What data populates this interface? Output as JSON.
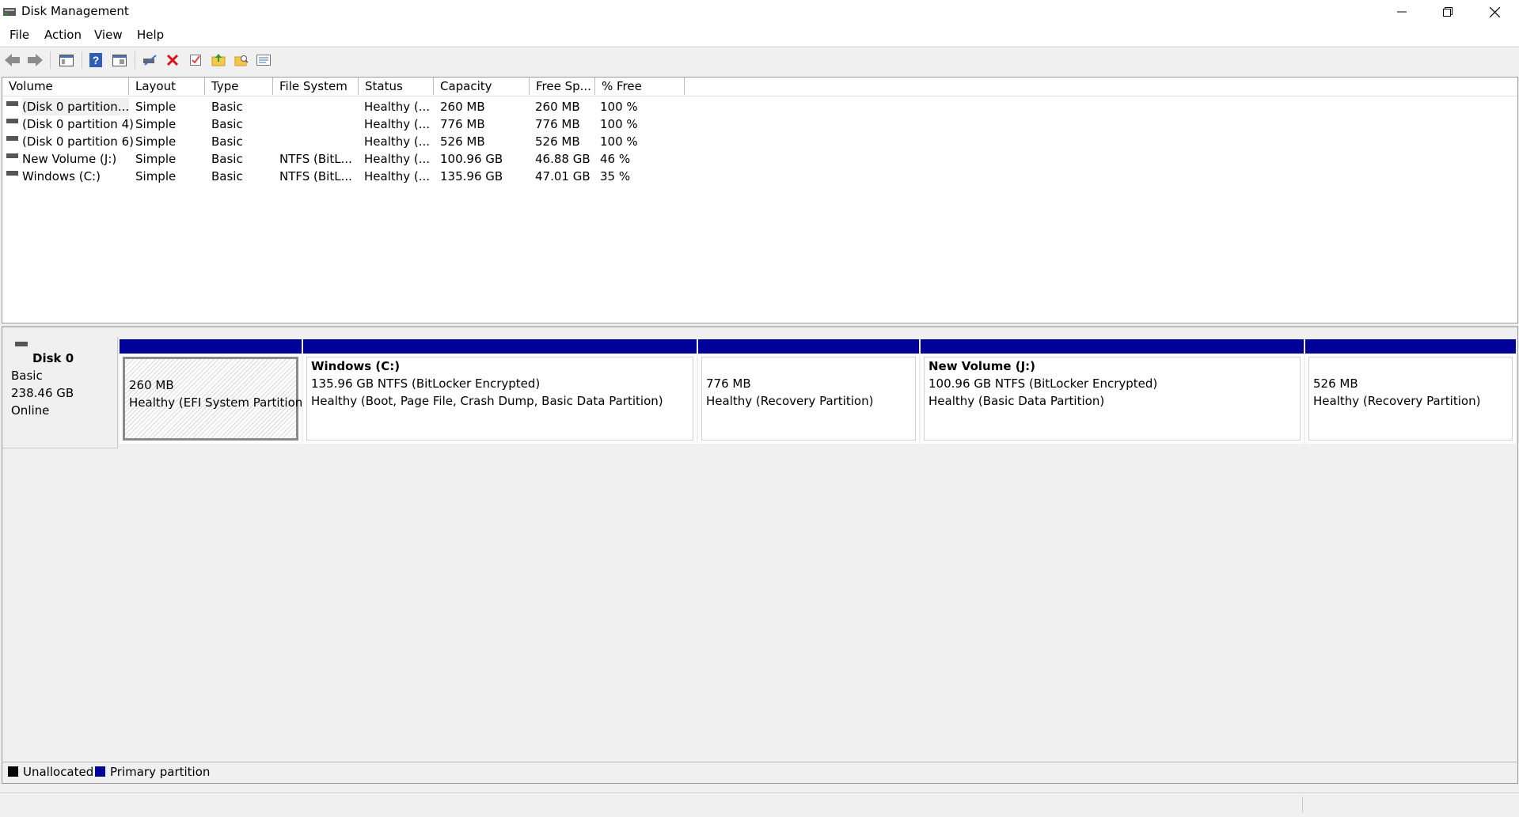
{
  "window": {
    "title": "Disk Management",
    "minimize_icon": "minimize-icon",
    "restore_icon": "restore-icon",
    "close_icon": "close-icon"
  },
  "menu": [
    "File",
    "Action",
    "View",
    "Help"
  ],
  "toolbar": {
    "icons": [
      "back-arrow-icon",
      "forward-arrow-icon",
      "console-tree-icon",
      "help-icon",
      "properties-pane-icon",
      "connect-disk-icon",
      "delete-icon",
      "check-icon",
      "folder-up-icon",
      "folder-search-icon",
      "details-icon"
    ]
  },
  "volume_list": {
    "columns": [
      "Volume",
      "Layout",
      "Type",
      "File System",
      "Status",
      "Capacity",
      "Free Sp...",
      "% Free"
    ],
    "rows": [
      {
        "volume": "(Disk 0 partition...",
        "layout": "Simple",
        "type": "Basic",
        "fs": "",
        "status": "Healthy (...",
        "capacity": "260 MB",
        "free": "260 MB",
        "pct": "100 %"
      },
      {
        "volume": "(Disk 0 partition 4)",
        "layout": "Simple",
        "type": "Basic",
        "fs": "",
        "status": "Healthy (...",
        "capacity": "776 MB",
        "free": "776 MB",
        "pct": "100 %"
      },
      {
        "volume": "(Disk 0 partition 6)",
        "layout": "Simple",
        "type": "Basic",
        "fs": "",
        "status": "Healthy (...",
        "capacity": "526 MB",
        "free": "526 MB",
        "pct": "100 %"
      },
      {
        "volume": "New Volume (J:)",
        "layout": "Simple",
        "type": "Basic",
        "fs": "NTFS (BitL...",
        "status": "Healthy (...",
        "capacity": "100.96 GB",
        "free": "46.88 GB",
        "pct": "46 %"
      },
      {
        "volume": "Windows (C:)",
        "layout": "Simple",
        "type": "Basic",
        "fs": "NTFS (BitL...",
        "status": "Healthy (...",
        "capacity": "135.96 GB",
        "free": "47.01 GB",
        "pct": "35 %"
      }
    ]
  },
  "disk": {
    "name": "Disk 0",
    "type": "Basic",
    "size": "238.46 GB",
    "state": "Online",
    "partitions": [
      {
        "title": "",
        "line1": "260 MB",
        "line2": "Healthy (EFI System Partition)"
      },
      {
        "title": "Windows  (C:)",
        "line1": "135.96 GB NTFS (BitLocker Encrypted)",
        "line2": "Healthy (Boot, Page File, Crash Dump, Basic Data Partition)"
      },
      {
        "title": "",
        "line1": "776 MB",
        "line2": "Healthy (Recovery Partition)"
      },
      {
        "title": "New Volume  (J:)",
        "line1": "100.96 GB NTFS (BitLocker Encrypted)",
        "line2": "Healthy (Basic Data Partition)"
      },
      {
        "title": "",
        "line1": "526 MB",
        "line2": "Healthy (Recovery Partition)"
      }
    ]
  },
  "legend": {
    "unallocated": "Unallocated",
    "primary": "Primary partition",
    "unallocated_color": "#000000",
    "primary_color": "#00009b"
  }
}
